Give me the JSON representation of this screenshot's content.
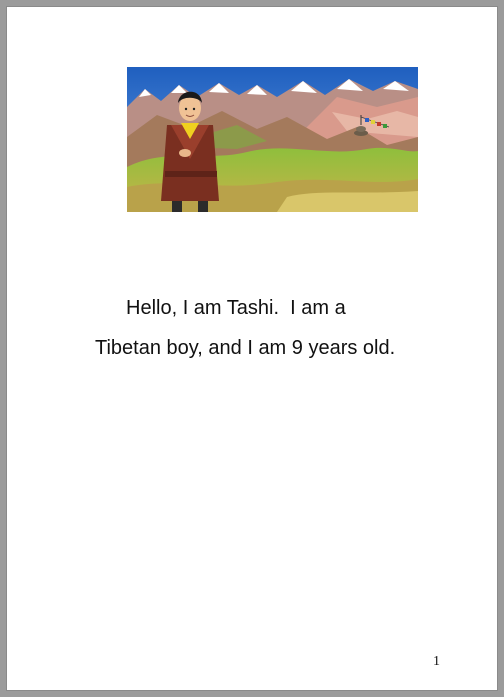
{
  "document": {
    "illustration": {
      "description_icon": "tibetan-boy-mountains-illustration"
    },
    "text": {
      "line1": "Hello, I am Tashi.  I am a",
      "line2": "Tibetan boy, and I am 9 years old."
    },
    "page_number": "1"
  },
  "colors": {
    "page_background": "#ffffff",
    "viewer_background": "#9b9b9b",
    "text": "#111111"
  }
}
